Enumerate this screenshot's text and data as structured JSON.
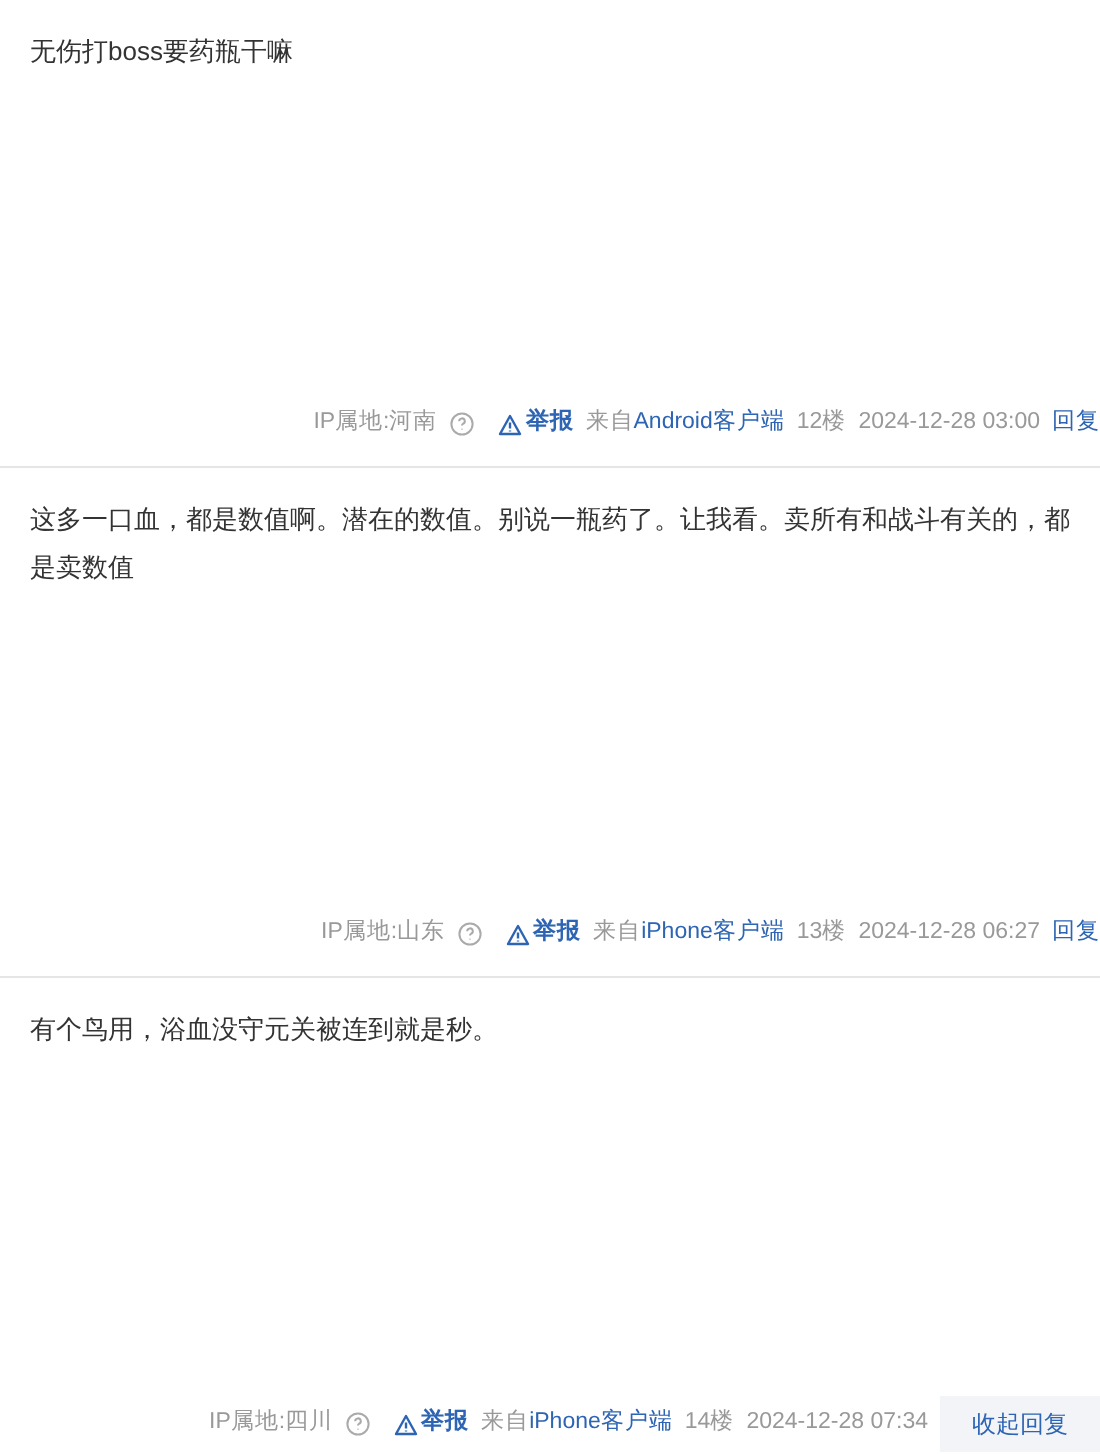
{
  "posts": [
    {
      "content": "无伤打boss要药瓶干嘛",
      "ip": "IP属地:河南",
      "report": "举报",
      "source_prefix": "来自",
      "client": "Android客户端",
      "floor": "12楼",
      "time": "2024-12-28 03:00",
      "action": {
        "kind": "link",
        "label": "回复"
      }
    },
    {
      "content": "这多一口血，都是数值啊。潜在的数值。别说一瓶药了。让我看。卖所有和战斗有关的，都是卖数值",
      "ip": "IP属地:山东",
      "report": "举报",
      "source_prefix": "来自",
      "client": "iPhone客户端",
      "floor": "13楼",
      "time": "2024-12-28 06:27",
      "action": {
        "kind": "link",
        "label": "回复"
      }
    },
    {
      "content": "有个鸟用，浴血没守元关被连到就是秒。",
      "ip": "IP属地:四川",
      "report": "举报",
      "source_prefix": "来自",
      "client": "iPhone客户端",
      "floor": "14楼",
      "time": "2024-12-28 07:34",
      "action": {
        "kind": "button",
        "label": "收起回复"
      }
    }
  ]
}
